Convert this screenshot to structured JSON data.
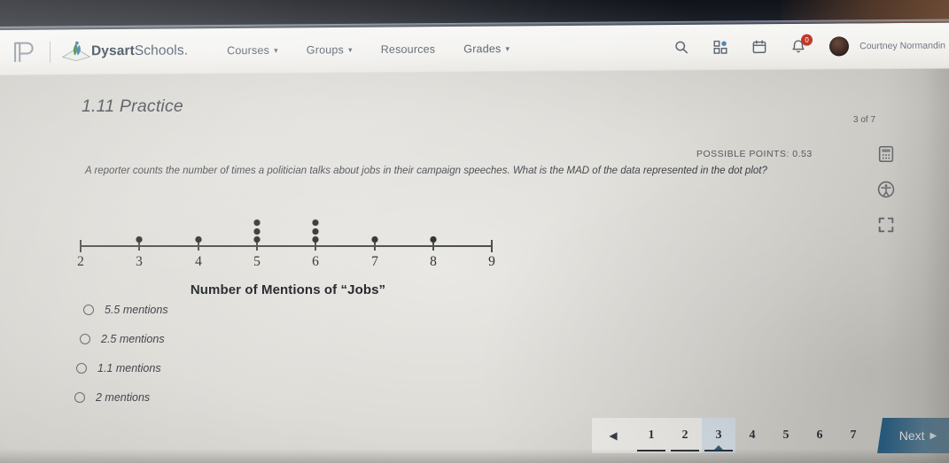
{
  "header": {
    "brand_bold": "Dysart",
    "brand_light": "Schools.",
    "ps_logo_name": "powerschool-logo",
    "nav_links": [
      {
        "label": "Courses",
        "has_caret": true
      },
      {
        "label": "Groups",
        "has_caret": true
      },
      {
        "label": "Resources",
        "has_caret": false
      },
      {
        "label": "Grades",
        "has_caret": true
      }
    ],
    "icons": [
      "search-icon",
      "apps-grid-icon",
      "calendar-icon",
      "notification-bell-icon"
    ],
    "notification_badge": "0",
    "username": "Courtney Normandin"
  },
  "assignment": {
    "title": "1.11 Practice",
    "progress": "3 of 7",
    "possible_points": "POSSIBLE POINTS: 0.53",
    "question": "A reporter counts the number of times a politician talks about jobs in their campaign speeches. What is the MAD of the data represented in the dot plot?"
  },
  "tools": {
    "calculator_icon": "calculator-icon",
    "accessibility_icon": "accessibility-icon",
    "fullscreen_icon": "fullscreen-expand-icon",
    "edge_chevron": "‹"
  },
  "options": [
    {
      "label": "5.5 mentions",
      "selected": false
    },
    {
      "label": "2.5 mentions",
      "selected": false
    },
    {
      "label": "1.1 mentions",
      "selected": false
    },
    {
      "label": "2 mentions",
      "selected": false
    }
  ],
  "pagination": {
    "prev_glyph": "◀",
    "pages": [
      {
        "label": "1",
        "state": "visited"
      },
      {
        "label": "2",
        "state": "visited"
      },
      {
        "label": "3",
        "state": "current"
      },
      {
        "label": "4",
        "state": "plain"
      },
      {
        "label": "5",
        "state": "plain"
      },
      {
        "label": "6",
        "state": "plain"
      },
      {
        "label": "7",
        "state": "plain"
      }
    ],
    "next_label": "Next",
    "next_arrow": "▶"
  },
  "colors": {
    "accent_blue": "#2a6186",
    "current_page_bg": "#d7e0e8",
    "badge_red": "#c0392b",
    "axis": "#4a4a4a",
    "dot": "#2b2b2b"
  },
  "chart_data": {
    "type": "scatter",
    "title": "",
    "xlabel": "Number of Mentions of “Jobs”",
    "ylabel": "",
    "xlim": [
      2,
      9
    ],
    "xticks": [
      "2",
      "3",
      "4",
      "5",
      "6",
      "7",
      "8",
      "9"
    ],
    "grid": false,
    "legend": "none",
    "categories": [
      2,
      3,
      4,
      5,
      6,
      7,
      8,
      9
    ],
    "values": [
      0,
      1,
      1,
      3,
      3,
      1,
      1,
      0
    ],
    "note": "dot plot: stacked dots above each integer tick"
  }
}
